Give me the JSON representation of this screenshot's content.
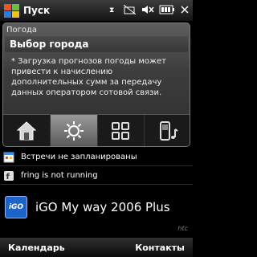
{
  "statusbar": {
    "title": "Пуск"
  },
  "weather": {
    "header": "Погода",
    "city": "Выбор города",
    "notice": "* Загрузка прогнозов погоды может привести к начислению дополнительных сумм за передачу данных оператором сотовой связи.",
    "tabs": [
      "home-icon",
      "settings-icon",
      "apps-icon",
      "phone-music-icon"
    ],
    "active_tab": 1
  },
  "rows": {
    "calendar": "Встречи не запланированы",
    "fring": "fring is not running"
  },
  "igo": {
    "logo": "iGO",
    "title": "iGO My way 2006 Plus"
  },
  "softkeys": {
    "left": "Календарь",
    "right": "Контакты"
  },
  "colors": {
    "accent_blue": "#1e64c8",
    "panel": "#3c3c3c"
  }
}
